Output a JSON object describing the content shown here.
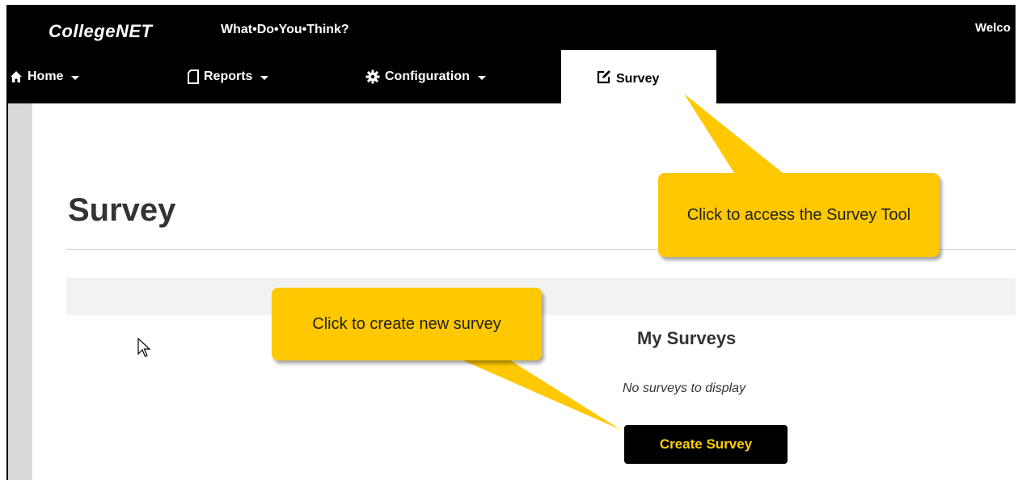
{
  "header": {
    "logo_text": "CollegeNET",
    "app_name": "What•Do•You•Think?",
    "welcome_text": "Welco"
  },
  "nav": {
    "items": [
      {
        "label": "Home",
        "icon": "home-icon"
      },
      {
        "label": "Reports",
        "icon": "document-icon"
      },
      {
        "label": "Configuration",
        "icon": "gear-icon"
      },
      {
        "label": "Survey",
        "icon": "edit-icon",
        "active": true
      }
    ]
  },
  "main": {
    "page_title": "Survey",
    "section_heading": "My Surveys",
    "empty_message": "No surveys to display",
    "create_button_label": "Create Survey"
  },
  "callouts": {
    "survey_tool": "Click to access the Survey Tool",
    "create_new": "Click to create new survey"
  },
  "colors": {
    "topbar": "#000000",
    "callout": "#ffc800",
    "button_text": "#ffd000"
  }
}
